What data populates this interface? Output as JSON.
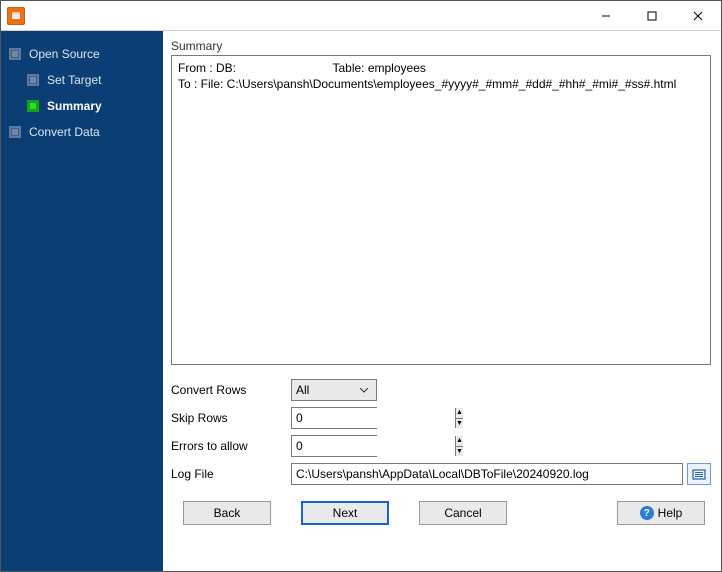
{
  "sidebar": {
    "items": [
      {
        "label": "Open Source"
      },
      {
        "label": "Set Target"
      },
      {
        "label": "Summary"
      },
      {
        "label": "Convert Data"
      }
    ]
  },
  "summary": {
    "title": "Summary",
    "from_label": "From : DB:",
    "table_label": "Table: employees",
    "to_line": "To : File: C:\\Users\\pansh\\Documents\\employees_#yyyy#_#mm#_#dd#_#hh#_#mi#_#ss#.html"
  },
  "form": {
    "convert_rows_label": "Convert Rows",
    "convert_rows_value": "All",
    "skip_rows_label": "Skip Rows",
    "skip_rows_value": "0",
    "errors_label": "Errors to allow",
    "errors_value": "0",
    "logfile_label": "Log File",
    "logfile_value": "C:\\Users\\pansh\\AppData\\Local\\DBToFile\\20240920.log"
  },
  "buttons": {
    "back": "Back",
    "next": "Next",
    "cancel": "Cancel",
    "help": "Help"
  }
}
